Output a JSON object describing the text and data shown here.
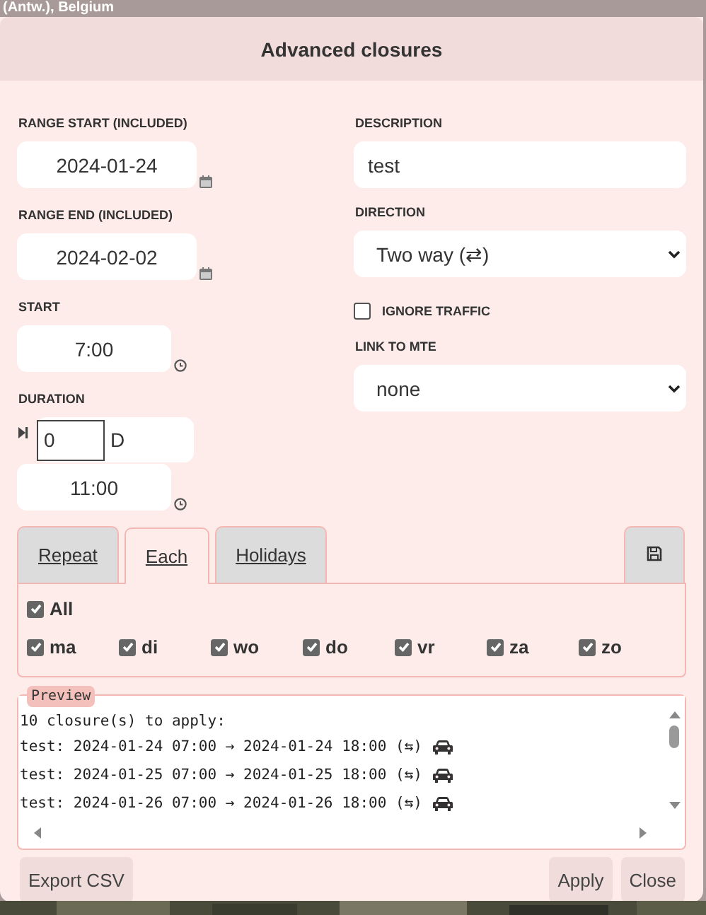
{
  "background": {
    "location": "(Antw.), Belgium"
  },
  "dialog": {
    "title": "Advanced closures",
    "range_start": {
      "label": "RANGE START (INCLUDED)",
      "value": "2024-01-24"
    },
    "range_end": {
      "label": "RANGE END (INCLUDED)",
      "value": "2024-02-02"
    },
    "start": {
      "label": "START",
      "value": "7:00"
    },
    "duration": {
      "label": "DURATION",
      "days": "0",
      "unit": "D",
      "time": "11:00"
    },
    "description": {
      "label": "DESCRIPTION",
      "value": "test"
    },
    "direction": {
      "label": "DIRECTION",
      "value": "Two way (⇄)"
    },
    "ignore_traffic": {
      "label": "IGNORE TRAFFIC",
      "checked": false
    },
    "link_to_mte": {
      "label": "LINK TO MTE",
      "value": "none"
    },
    "tabs": [
      {
        "label": "Repeat",
        "selected": false
      },
      {
        "label": "Each",
        "selected": true
      },
      {
        "label": "Holidays",
        "selected": false
      }
    ],
    "all": {
      "label": "All",
      "checked": true
    },
    "days": [
      {
        "label": "ma",
        "checked": true
      },
      {
        "label": "di",
        "checked": true
      },
      {
        "label": "wo",
        "checked": true
      },
      {
        "label": "do",
        "checked": true
      },
      {
        "label": "vr",
        "checked": true
      },
      {
        "label": "za",
        "checked": true
      },
      {
        "label": "zo",
        "checked": true
      }
    ],
    "preview": {
      "label": "Preview",
      "lines": [
        {
          "kind": "summary",
          "text": "10 closure(s) to apply:"
        },
        {
          "kind": "closure",
          "text": "test: 2024-01-24 07:00 → 2024-01-24 18:00 (⇆)"
        },
        {
          "kind": "closure",
          "text": "test: 2024-01-25 07:00 → 2024-01-25 18:00 (⇆)"
        },
        {
          "kind": "closure",
          "text": "test: 2024-01-26 07:00 → 2024-01-26 18:00 (⇆)"
        }
      ]
    },
    "buttons_left": [
      "Export CSV"
    ],
    "buttons_right": [
      "Apply",
      "Close"
    ]
  }
}
